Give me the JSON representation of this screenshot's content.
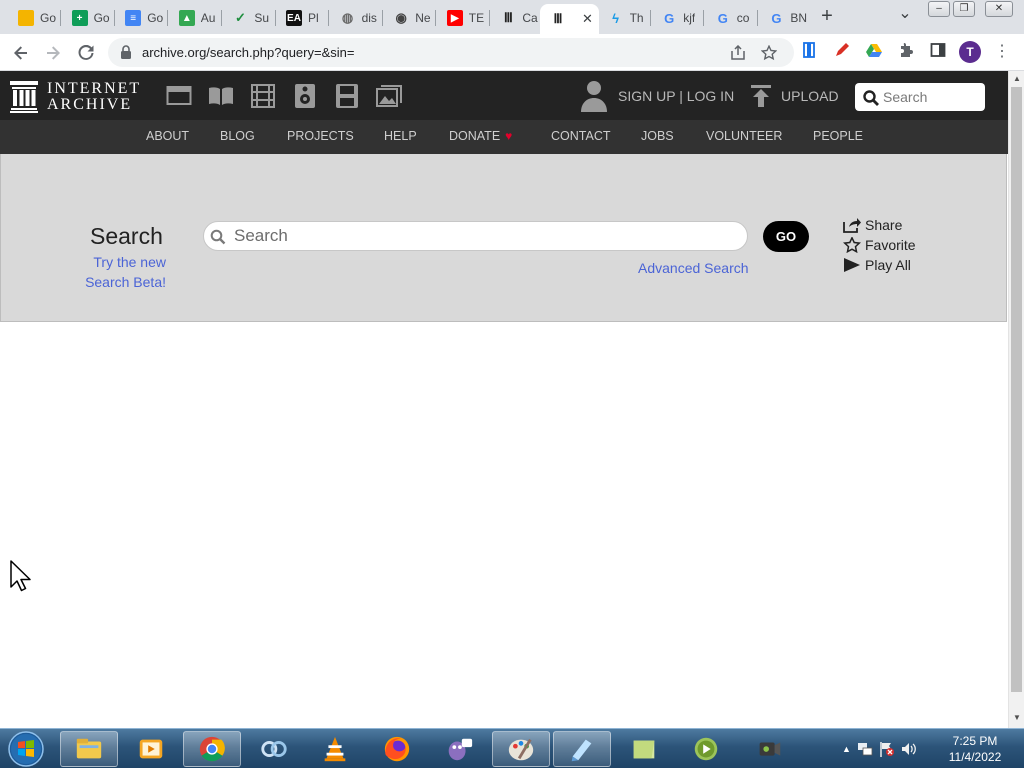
{
  "browser": {
    "tabs": [
      {
        "label": "Go",
        "icon": "slides-icon",
        "color": "#f4b400"
      },
      {
        "label": "Go",
        "icon": "sheets-icon",
        "color": "#0f9d58"
      },
      {
        "label": "Go",
        "icon": "docs-icon",
        "color": "#4285f4"
      },
      {
        "label": "Au",
        "icon": "drive-icon",
        "color": "#34a853"
      },
      {
        "label": "Su",
        "icon": "bird-icon",
        "color": "#1e8e3e"
      },
      {
        "label": "Pl",
        "icon": "ea-icon",
        "color": "#111111"
      },
      {
        "label": "dis",
        "icon": "globe-icon",
        "color": "#6b6b6b"
      },
      {
        "label": "Ne",
        "icon": "chrome-icon",
        "color": "#444444"
      },
      {
        "label": "TE",
        "icon": "youtube-icon",
        "color": "#ff0000"
      },
      {
        "label": "Ca",
        "icon": "archive-icon",
        "color": "#222222"
      },
      {
        "label": "",
        "icon": "archive-icon",
        "color": "#222222",
        "active": true
      },
      {
        "label": "Th",
        "icon": "bolt-icon",
        "color": "#1a9be6"
      },
      {
        "label": "kjf",
        "icon": "google-icon",
        "color": "#4285f4"
      },
      {
        "label": "co",
        "icon": "google-icon",
        "color": "#4285f4"
      },
      {
        "label": "BN",
        "icon": "google-icon",
        "color": "#4285f4"
      }
    ],
    "close_glyph": "✕",
    "new_tab_glyph": "+",
    "url": "archive.org/search.php?query=&sin=",
    "profile_initial": "T"
  },
  "ia": {
    "logo_line1": "INTERNET",
    "logo_line2": "ARCHIVE",
    "media_icons": [
      "web-icon",
      "texts-icon",
      "video-icon",
      "audio-icon",
      "software-icon",
      "images-icon"
    ],
    "sign_up_login": "SIGN UP | LOG IN",
    "upload": "UPLOAD",
    "search_placeholder": "Search",
    "nav": [
      {
        "label": "ABOUT"
      },
      {
        "label": "BLOG"
      },
      {
        "label": "PROJECTS"
      },
      {
        "label": "HELP"
      },
      {
        "label": "DONATE",
        "heart": "♥"
      },
      {
        "label": "CONTACT"
      },
      {
        "label": "JOBS"
      },
      {
        "label": "VOLUNTEER"
      },
      {
        "label": "PEOPLE"
      }
    ]
  },
  "search": {
    "heading": "Search",
    "try_new_line1": "Try the new",
    "try_new_line2": "Search Beta!",
    "placeholder": "Search",
    "go_label": "GO",
    "advanced_label": "Advanced Search",
    "actions": [
      {
        "label": "Share",
        "icon": "share-icon"
      },
      {
        "label": "Favorite",
        "icon": "star-icon"
      },
      {
        "label": "Play All",
        "icon": "play-icon"
      }
    ]
  },
  "taskbar": {
    "apps": [
      "file-explorer-icon",
      "media-player-icon",
      "chrome-icon",
      "network-icon",
      "vlc-icon",
      "firefox-icon",
      "pidgin-icon",
      "paint-icon",
      "notepad-icon",
      "notes-icon",
      "play-icon",
      "camera-icon"
    ],
    "time": "7:25 PM",
    "date": "11/4/2022"
  }
}
